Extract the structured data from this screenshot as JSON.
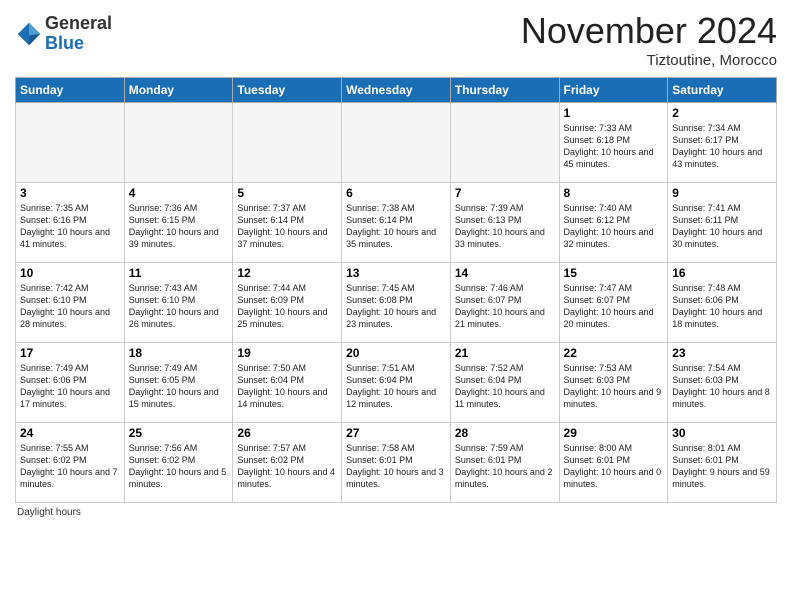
{
  "header": {
    "title": "November 2024",
    "location": "Tiztoutine, Morocco",
    "logo_line1": "General",
    "logo_line2": "Blue"
  },
  "days_of_week": [
    "Sunday",
    "Monday",
    "Tuesday",
    "Wednesday",
    "Thursday",
    "Friday",
    "Saturday"
  ],
  "weeks": [
    [
      {
        "day": "",
        "info": ""
      },
      {
        "day": "",
        "info": ""
      },
      {
        "day": "",
        "info": ""
      },
      {
        "day": "",
        "info": ""
      },
      {
        "day": "",
        "info": ""
      },
      {
        "day": "1",
        "info": "Sunrise: 7:33 AM\nSunset: 6:18 PM\nDaylight: 10 hours and 45 minutes."
      },
      {
        "day": "2",
        "info": "Sunrise: 7:34 AM\nSunset: 6:17 PM\nDaylight: 10 hours and 43 minutes."
      }
    ],
    [
      {
        "day": "3",
        "info": "Sunrise: 7:35 AM\nSunset: 6:16 PM\nDaylight: 10 hours and 41 minutes."
      },
      {
        "day": "4",
        "info": "Sunrise: 7:36 AM\nSunset: 6:15 PM\nDaylight: 10 hours and 39 minutes."
      },
      {
        "day": "5",
        "info": "Sunrise: 7:37 AM\nSunset: 6:14 PM\nDaylight: 10 hours and 37 minutes."
      },
      {
        "day": "6",
        "info": "Sunrise: 7:38 AM\nSunset: 6:14 PM\nDaylight: 10 hours and 35 minutes."
      },
      {
        "day": "7",
        "info": "Sunrise: 7:39 AM\nSunset: 6:13 PM\nDaylight: 10 hours and 33 minutes."
      },
      {
        "day": "8",
        "info": "Sunrise: 7:40 AM\nSunset: 6:12 PM\nDaylight: 10 hours and 32 minutes."
      },
      {
        "day": "9",
        "info": "Sunrise: 7:41 AM\nSunset: 6:11 PM\nDaylight: 10 hours and 30 minutes."
      }
    ],
    [
      {
        "day": "10",
        "info": "Sunrise: 7:42 AM\nSunset: 6:10 PM\nDaylight: 10 hours and 28 minutes."
      },
      {
        "day": "11",
        "info": "Sunrise: 7:43 AM\nSunset: 6:10 PM\nDaylight: 10 hours and 26 minutes."
      },
      {
        "day": "12",
        "info": "Sunrise: 7:44 AM\nSunset: 6:09 PM\nDaylight: 10 hours and 25 minutes."
      },
      {
        "day": "13",
        "info": "Sunrise: 7:45 AM\nSunset: 6:08 PM\nDaylight: 10 hours and 23 minutes."
      },
      {
        "day": "14",
        "info": "Sunrise: 7:46 AM\nSunset: 6:07 PM\nDaylight: 10 hours and 21 minutes."
      },
      {
        "day": "15",
        "info": "Sunrise: 7:47 AM\nSunset: 6:07 PM\nDaylight: 10 hours and 20 minutes."
      },
      {
        "day": "16",
        "info": "Sunrise: 7:48 AM\nSunset: 6:06 PM\nDaylight: 10 hours and 18 minutes."
      }
    ],
    [
      {
        "day": "17",
        "info": "Sunrise: 7:49 AM\nSunset: 6:06 PM\nDaylight: 10 hours and 17 minutes."
      },
      {
        "day": "18",
        "info": "Sunrise: 7:49 AM\nSunset: 6:05 PM\nDaylight: 10 hours and 15 minutes."
      },
      {
        "day": "19",
        "info": "Sunrise: 7:50 AM\nSunset: 6:04 PM\nDaylight: 10 hours and 14 minutes."
      },
      {
        "day": "20",
        "info": "Sunrise: 7:51 AM\nSunset: 6:04 PM\nDaylight: 10 hours and 12 minutes."
      },
      {
        "day": "21",
        "info": "Sunrise: 7:52 AM\nSunset: 6:04 PM\nDaylight: 10 hours and 11 minutes."
      },
      {
        "day": "22",
        "info": "Sunrise: 7:53 AM\nSunset: 6:03 PM\nDaylight: 10 hours and 9 minutes."
      },
      {
        "day": "23",
        "info": "Sunrise: 7:54 AM\nSunset: 6:03 PM\nDaylight: 10 hours and 8 minutes."
      }
    ],
    [
      {
        "day": "24",
        "info": "Sunrise: 7:55 AM\nSunset: 6:02 PM\nDaylight: 10 hours and 7 minutes."
      },
      {
        "day": "25",
        "info": "Sunrise: 7:56 AM\nSunset: 6:02 PM\nDaylight: 10 hours and 5 minutes."
      },
      {
        "day": "26",
        "info": "Sunrise: 7:57 AM\nSunset: 6:02 PM\nDaylight: 10 hours and 4 minutes."
      },
      {
        "day": "27",
        "info": "Sunrise: 7:58 AM\nSunset: 6:01 PM\nDaylight: 10 hours and 3 minutes."
      },
      {
        "day": "28",
        "info": "Sunrise: 7:59 AM\nSunset: 6:01 PM\nDaylight: 10 hours and 2 minutes."
      },
      {
        "day": "29",
        "info": "Sunrise: 8:00 AM\nSunset: 6:01 PM\nDaylight: 10 hours and 0 minutes."
      },
      {
        "day": "30",
        "info": "Sunrise: 8:01 AM\nSunset: 6:01 PM\nDaylight: 9 hours and 59 minutes."
      }
    ]
  ],
  "footer": {
    "note": "Daylight hours"
  }
}
